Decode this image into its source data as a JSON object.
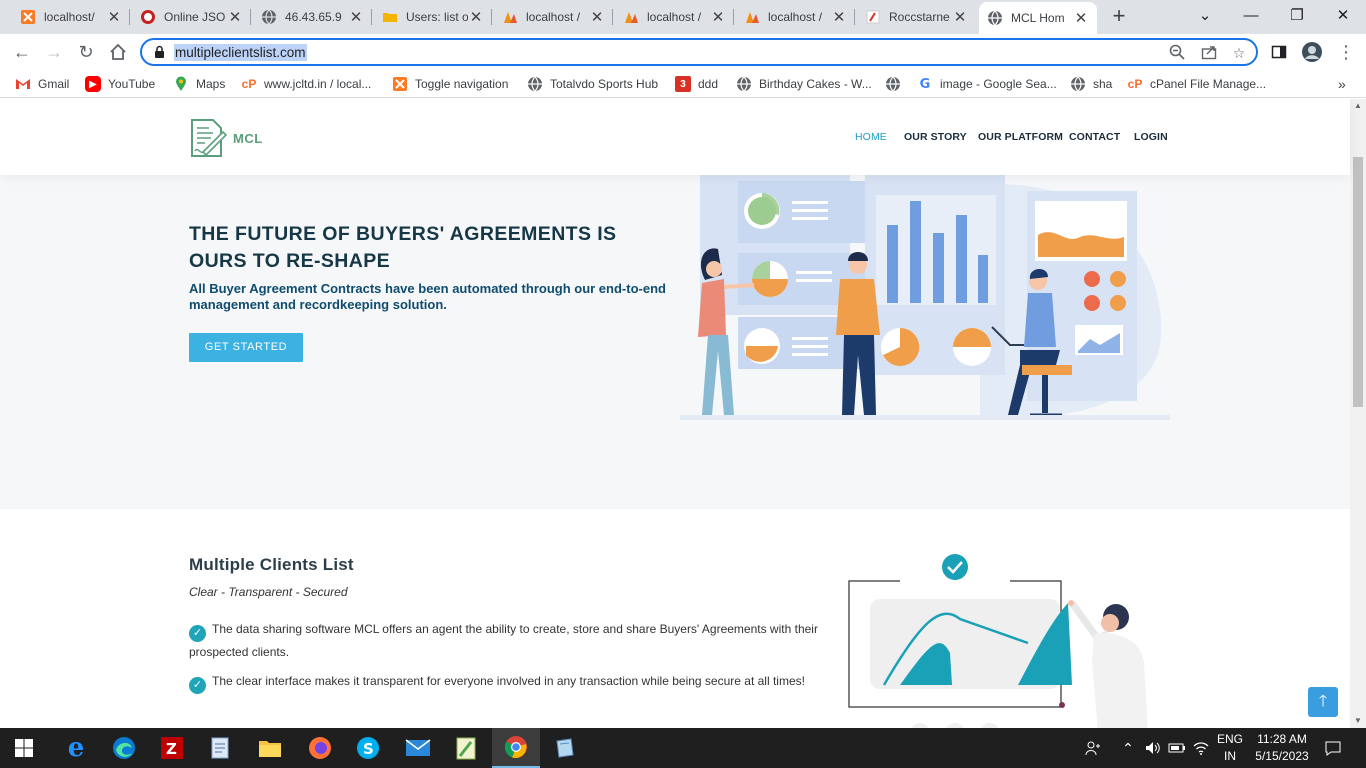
{
  "browser": {
    "tabs": [
      {
        "title": "localhost/",
        "icon": "xampp-icon"
      },
      {
        "title": "Online JSO",
        "icon": "json-icon"
      },
      {
        "title": "46.43.65.9",
        "icon": "globe-icon"
      },
      {
        "title": "Users: list o",
        "icon": "folder-icon"
      },
      {
        "title": "localhost /",
        "icon": "phpmyadmin-icon"
      },
      {
        "title": "localhost /",
        "icon": "phpmyadmin-icon"
      },
      {
        "title": "localhost /",
        "icon": "phpmyadmin-icon"
      },
      {
        "title": "Roccstarne",
        "icon": "site-icon"
      },
      {
        "title": "MCL Hom",
        "icon": "globe-icon",
        "active": true
      }
    ],
    "url": "multipleclientslist.com",
    "bookmarks": [
      {
        "label": "Gmail",
        "icon": "gmail-icon"
      },
      {
        "label": "YouTube",
        "icon": "youtube-icon"
      },
      {
        "label": "Maps",
        "icon": "maps-icon"
      },
      {
        "label": "www.jcltd.in / local...",
        "icon": "cpanel-icon"
      },
      {
        "label": "Toggle navigation",
        "icon": "xampp-icon"
      },
      {
        "label": "Totalvdo Sports Hub",
        "icon": "globe-icon"
      },
      {
        "label": "ddd",
        "icon": "site-icon"
      },
      {
        "label": "Birthday Cakes - W...",
        "icon": "globe-icon"
      },
      {
        "label": "image - Google Sea...",
        "icon": "google-icon"
      },
      {
        "label": "sha",
        "icon": "globe-icon"
      },
      {
        "label": "cPanel File Manage...",
        "icon": "cpanel-icon"
      }
    ]
  },
  "site": {
    "logo": "MCL",
    "nav": [
      "HOME",
      "OUR STORY",
      "OUR PLATFORM",
      "CONTACT",
      "LOGIN"
    ],
    "hero": {
      "title": "THE FUTURE OF BUYERS' AGREEMENTS IS OURS TO RE-SHAPE",
      "subtitle": "All Buyer Agreement Contracts have been automated through our end-to-end management and recordkeeping solution.",
      "cta": "GET STARTED"
    },
    "section": {
      "title": "Multiple Clients List",
      "tagline": "Clear - Transparent - Secured",
      "bullets": [
        "The data sharing software MCL offers an agent the ability to create, store and share Buyers' Agreements with their prospected clients.",
        "The clear interface makes it transparent for everyone involved in any transaction while being secure at all times!"
      ]
    },
    "colors": {
      "accent": "#1aa1c4",
      "cta": "#3cb2e3",
      "heroBg": "#f6f7f9",
      "title": "#163746"
    }
  },
  "taskbar": {
    "apps": [
      "windows-start-icon",
      "edge-legacy-icon",
      "edge-icon",
      "filezilla-icon",
      "notepad-icon",
      "file-explorer-icon",
      "firefox-icon",
      "skype-icon",
      "mail-icon",
      "notepadpp-icon",
      "chrome-icon",
      "app-icon"
    ],
    "lang_top": "ENG",
    "lang_bottom": "IN",
    "time": "11:28 AM",
    "date": "5/15/2023"
  }
}
